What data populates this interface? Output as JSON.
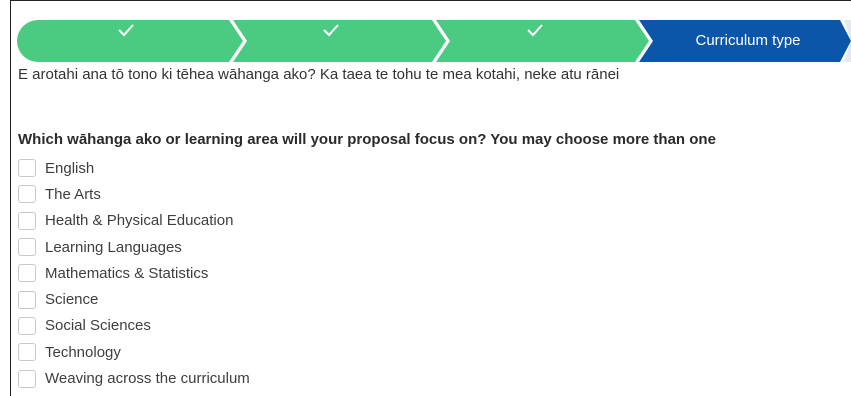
{
  "progress_path": {
    "steps": [
      {
        "label": "",
        "status": "complete",
        "icon": "check-icon"
      },
      {
        "label": "",
        "status": "complete",
        "icon": "check-icon"
      },
      {
        "label": "",
        "status": "complete",
        "icon": "check-icon"
      },
      {
        "label": "Curriculum type",
        "status": "current"
      }
    ],
    "colors": {
      "complete": "#4bca81",
      "current": "#0b56a8",
      "incomplete": "#e5e8ee"
    }
  },
  "form": {
    "question_mi": "E arotahi ana tō tono ki tēhea wāhanga ako? Ka taea te tohu te mea kotahi, neke atu rānei",
    "question_en": "Which wāhanga ako or learning area will your proposal focus on? You may choose more than one",
    "options": [
      {
        "label": "English",
        "checked": false
      },
      {
        "label": "The Arts",
        "checked": false
      },
      {
        "label": "Health & Physical Education",
        "checked": false
      },
      {
        "label": "Learning Languages",
        "checked": false
      },
      {
        "label": "Mathematics & Statistics",
        "checked": false
      },
      {
        "label": "Science",
        "checked": false
      },
      {
        "label": "Social Sciences",
        "checked": false
      },
      {
        "label": "Technology",
        "checked": false
      },
      {
        "label": "Weaving across the curriculum",
        "checked": false
      }
    ]
  }
}
